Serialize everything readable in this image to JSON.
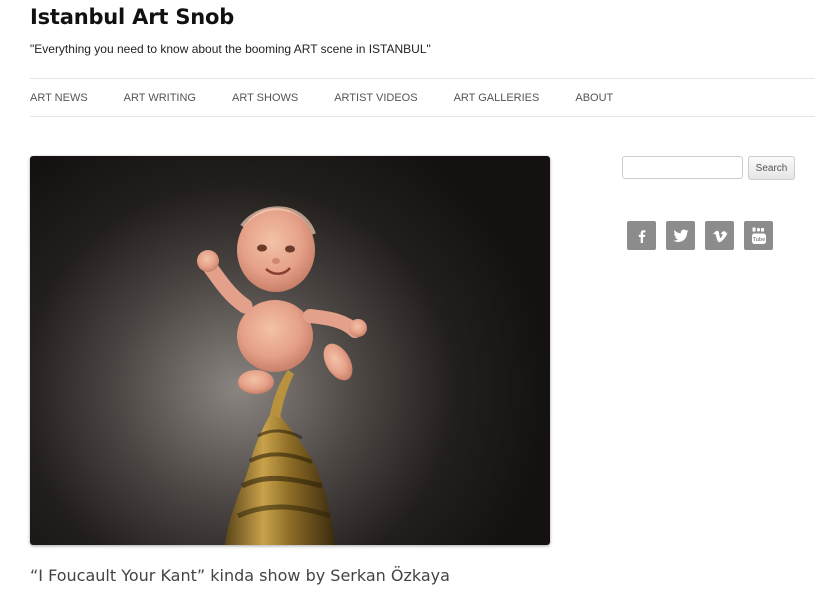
{
  "header": {
    "site_title": "Istanbul Art Snob",
    "tagline": "\"Everything you need to know about the booming ART scene in ISTANBUL\""
  },
  "nav": {
    "items": [
      "ART NEWS",
      "ART WRITING",
      "ART SHOWS",
      "ARTIST VIDEOS",
      "ART GALLERIES",
      "ABOUT"
    ]
  },
  "sidebar": {
    "search": {
      "value": "",
      "button_label": "Search"
    },
    "social": [
      "facebook-icon",
      "twitter-icon",
      "vimeo-icon",
      "youtube-icon"
    ]
  },
  "post": {
    "title": "“I Foucault Your Kant” kinda show by Serkan Özkaya"
  },
  "colors": {
    "social_bg": "#8c8c8c",
    "text": "#444444",
    "title": "#111111"
  }
}
